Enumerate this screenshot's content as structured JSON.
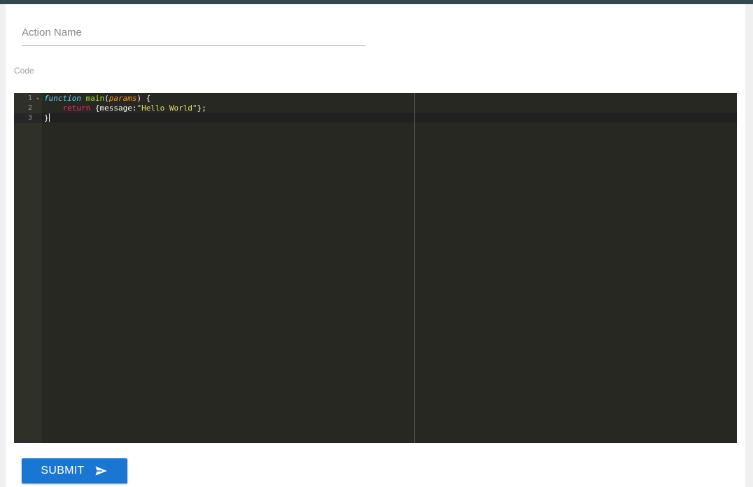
{
  "form": {
    "action_name_placeholder": "Action Name",
    "action_name_value": "",
    "code_label": "Code",
    "submit_label": "SUBMIT"
  },
  "editor": {
    "theme": "monokai",
    "active_line": 3,
    "lines": [
      {
        "number": "1",
        "foldable": true
      },
      {
        "number": "2",
        "foldable": false
      },
      {
        "number": "3",
        "foldable": false
      }
    ],
    "tokens": {
      "l1_function": "function",
      "l1_main": "main",
      "l1_paren_open": "(",
      "l1_params": "params",
      "l1_paren_close": ") {",
      "l2_indent": "    ",
      "l2_return": "return",
      "l2_obj_open": " {message:",
      "l2_string": "\"Hello World\"",
      "l2_obj_close": "};",
      "l3_brace": "}"
    }
  },
  "colors": {
    "primary": "#1976d2",
    "editor_background": "#272822",
    "top_bar": "#37474f"
  },
  "icons": {
    "submit": "send-icon",
    "fold": "fold-arrow-icon"
  }
}
